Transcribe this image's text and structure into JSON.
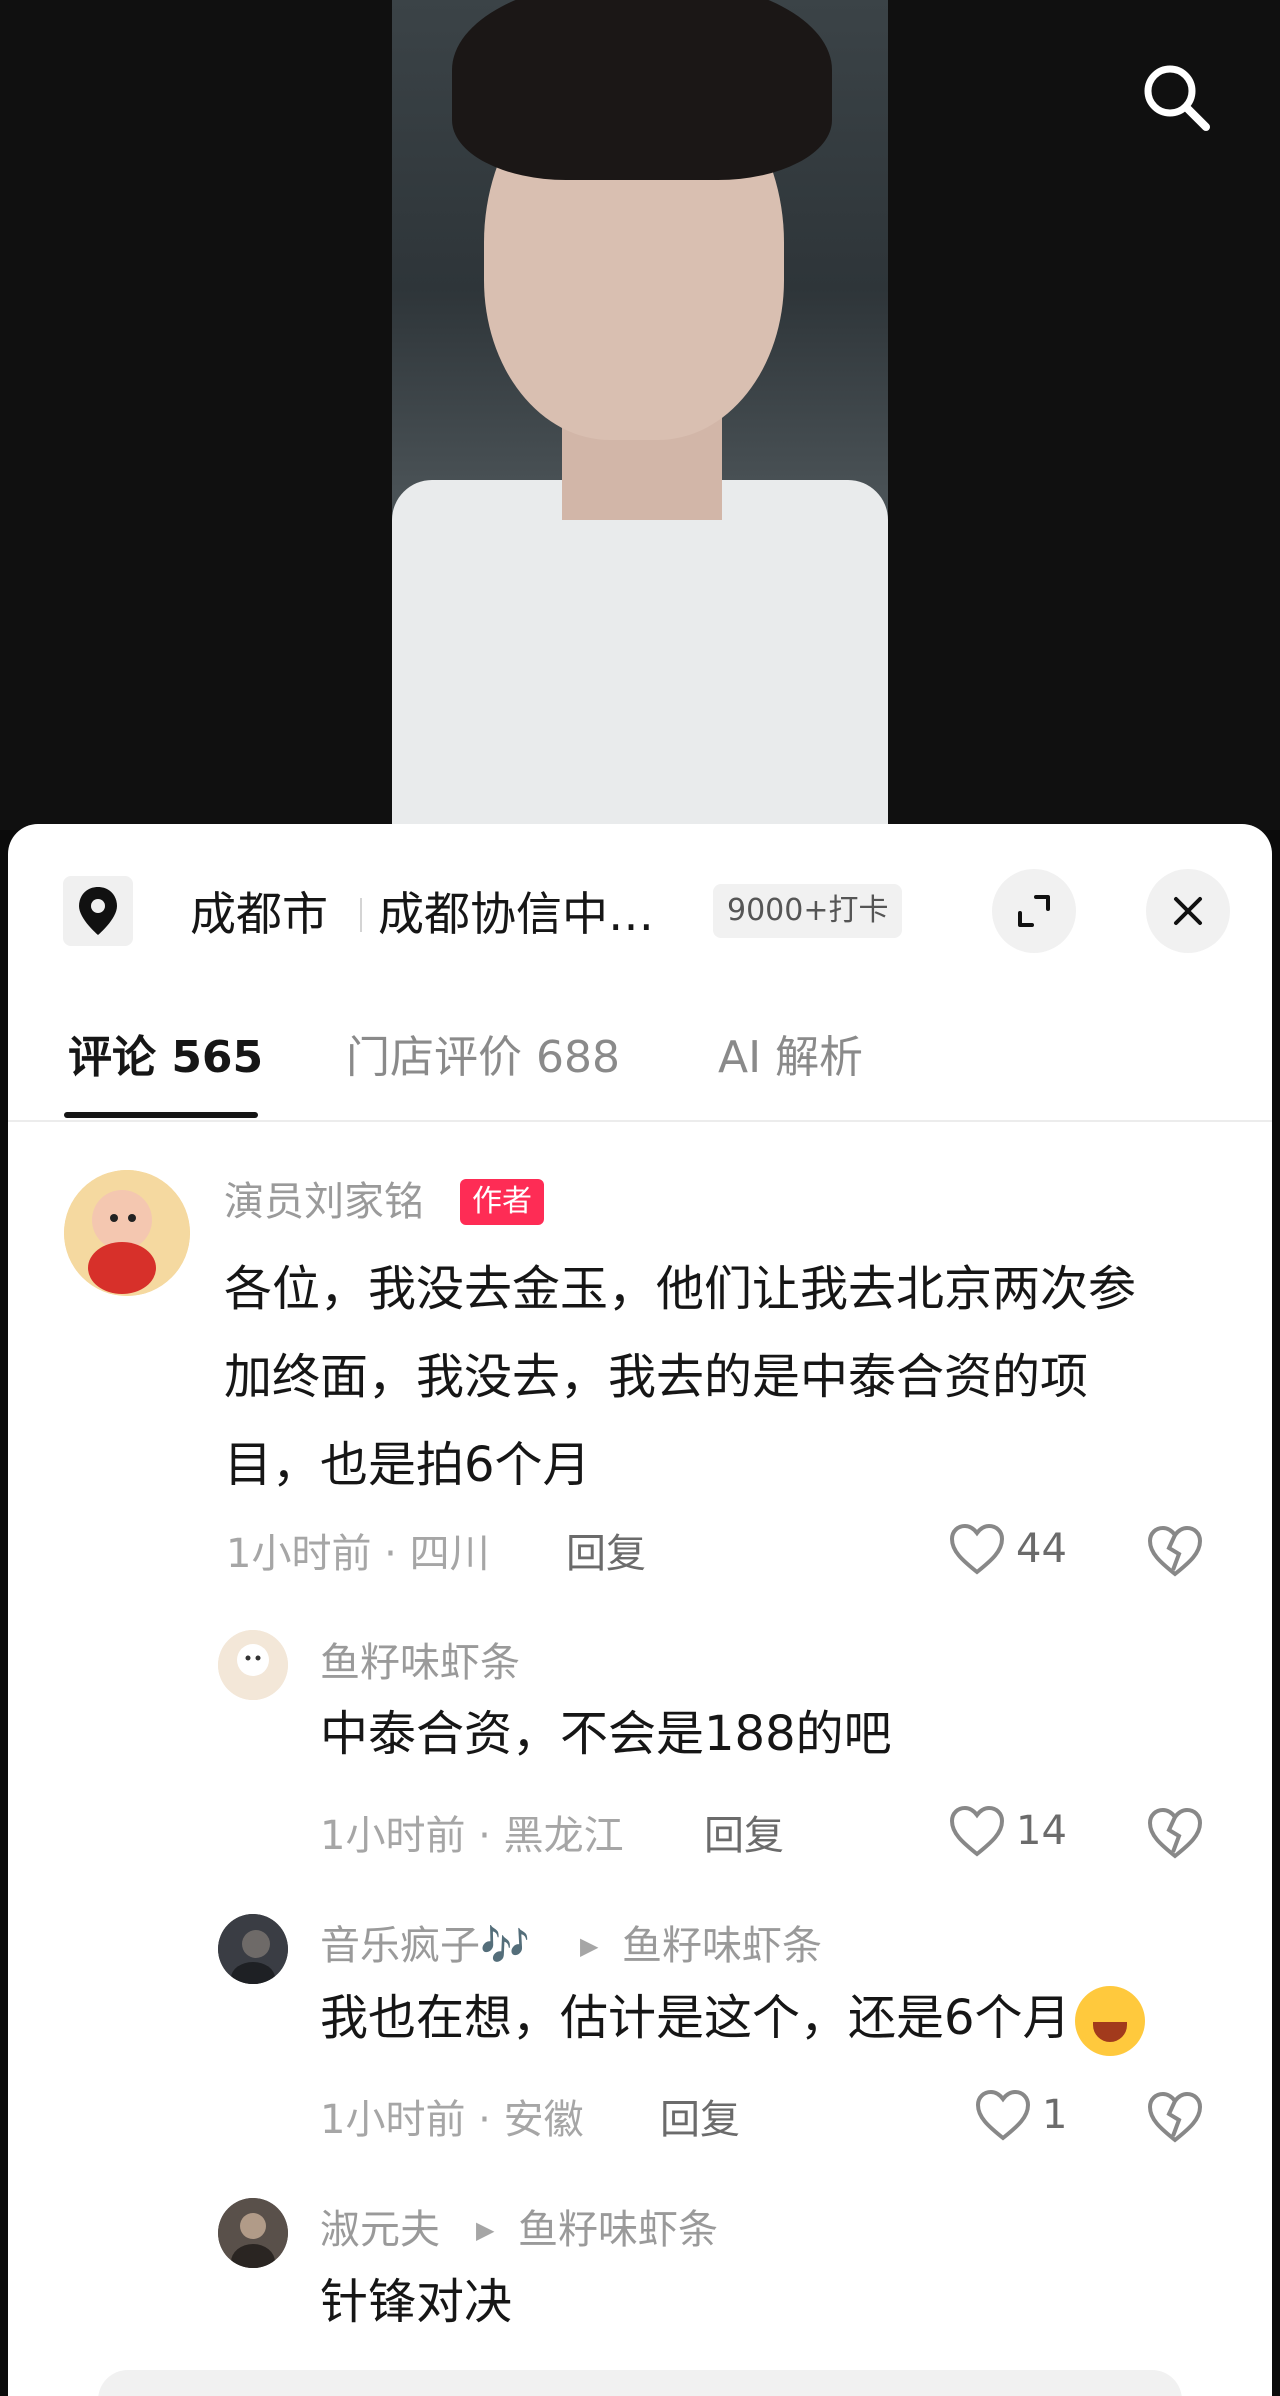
{
  "location": {
    "city": "成都市",
    "place": "成都协信中…",
    "checkins": "9000+打卡"
  },
  "tabs": [
    {
      "label": "评论 565",
      "active": true
    },
    {
      "label": "门店评价 688",
      "active": false
    },
    {
      "label": "AI 解析",
      "active": false
    }
  ],
  "comments": [
    {
      "author": "演员刘家铭",
      "badge": "作者",
      "text_lines": [
        "各位，我没去金玉，他们让我去北京两次参",
        "加终面，我没去，我去的是中泰合资的项",
        "目，也是拍6个月"
      ],
      "time": "1小时前 · 四川",
      "reply_label": "回复",
      "likes": "44"
    },
    {
      "author": "鱼籽味虾条",
      "text": "中泰合资，不会是188的吧",
      "time": "1小时前 · 黑龙江",
      "reply_label": "回复",
      "likes": "14"
    },
    {
      "author": "音乐疯子🎶",
      "reply_to": "鱼籽味虾条",
      "text": "我也在想，估计是这个，还是6个月",
      "time": "1小时前 · 安徽",
      "reply_label": "回复",
      "likes": "1"
    },
    {
      "author": "淑元夫",
      "reply_to": "鱼籽味虾条",
      "text": "针锋对决"
    }
  ],
  "colors": {
    "accent": "#fe2c55",
    "text_primary": "#161616",
    "text_secondary": "#9a9a9a"
  }
}
